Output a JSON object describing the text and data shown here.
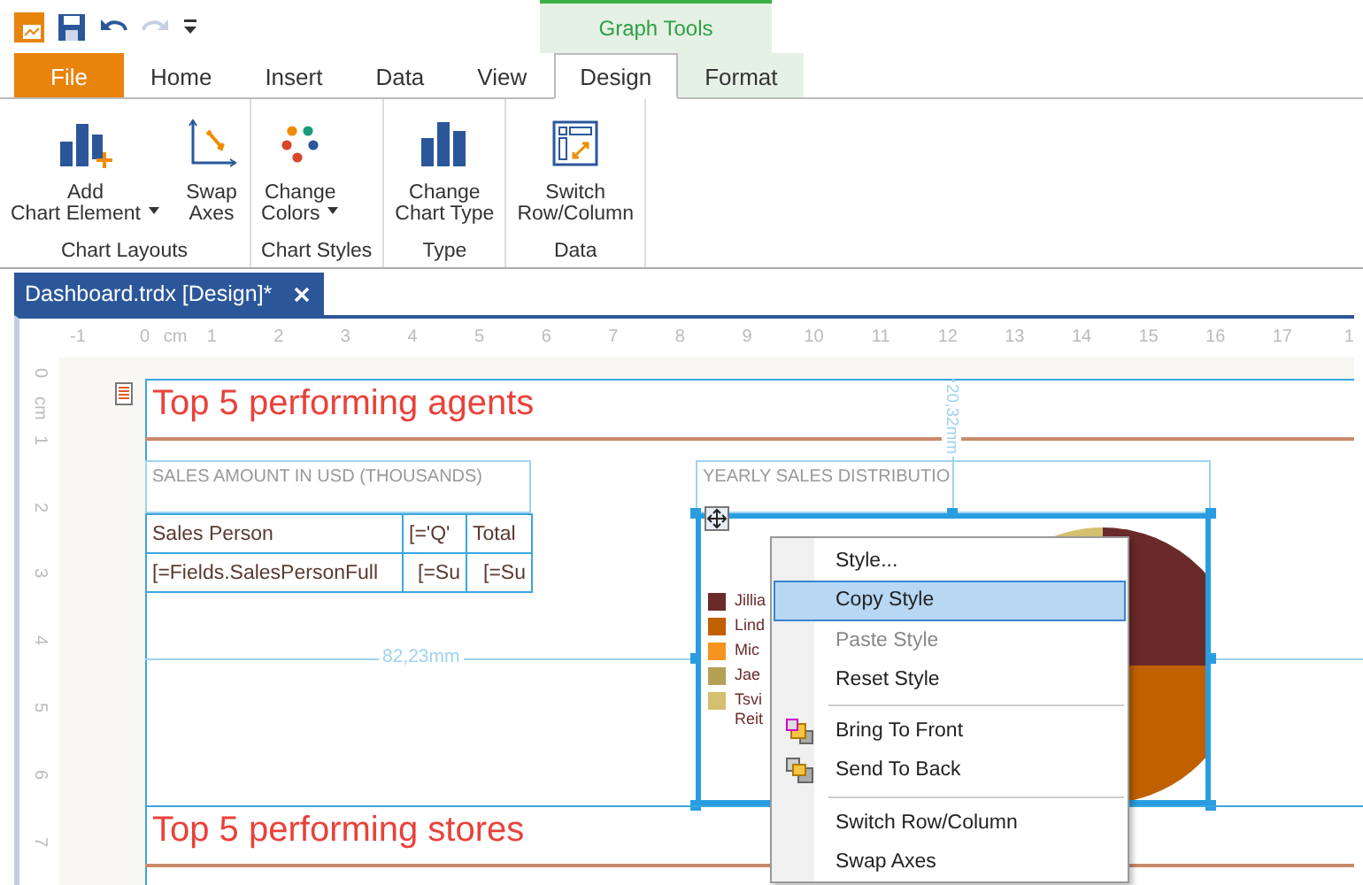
{
  "contextual_group": {
    "label": "Graph Tools"
  },
  "tabs": [
    {
      "label": "File",
      "kind": "file",
      "selected": false
    },
    {
      "label": "Home",
      "kind": "plain",
      "selected": false
    },
    {
      "label": "Insert",
      "kind": "plain",
      "selected": false
    },
    {
      "label": "Data",
      "kind": "plain",
      "selected": false
    },
    {
      "label": "View",
      "kind": "plain",
      "selected": false
    },
    {
      "label": "Design",
      "kind": "contextual",
      "selected": true
    },
    {
      "label": "Format",
      "kind": "contextual",
      "selected": false
    }
  ],
  "ribbon_groups": [
    {
      "label": "Chart Layouts",
      "buttons": [
        {
          "kind": "add",
          "lines": [
            "Add",
            "Chart Element"
          ],
          "dropdown": true
        },
        {
          "kind": "swap",
          "lines": [
            "Swap",
            "Axes"
          ],
          "dropdown": false
        }
      ]
    },
    {
      "label": "Chart Styles",
      "buttons": [
        {
          "kind": "colors",
          "lines": [
            "Change",
            "Colors"
          ],
          "dropdown": true
        }
      ]
    },
    {
      "label": "Type",
      "buttons": [
        {
          "kind": "type",
          "lines": [
            "Change",
            "Chart Type"
          ],
          "dropdown": false
        }
      ]
    },
    {
      "label": "Data",
      "buttons": [
        {
          "kind": "switch",
          "lines": [
            "Switch",
            "Row/Column"
          ],
          "dropdown": false
        }
      ]
    }
  ],
  "document_tab": {
    "title": "Dashboard.trdx [Design]*"
  },
  "ruler": {
    "unit_horizontal": "cm",
    "unit_vertical": "cm",
    "horizontal": [
      "-1",
      "0",
      "1",
      "2",
      "3",
      "4",
      "5",
      "6",
      "7",
      "8",
      "9",
      "10",
      "11",
      "12",
      "13",
      "14",
      "15",
      "16",
      "17",
      "1"
    ],
    "vertical": [
      "0",
      "1",
      "2",
      "3",
      "4",
      "5",
      "6",
      "7"
    ]
  },
  "report": {
    "agents_title": "Top 5 performing agents",
    "sales_title": "SALES AMOUNT IN USD (THOUSANDS)",
    "table": {
      "rows": [
        [
          "Sales Person",
          "[='Q'",
          "Total"
        ],
        [
          "[=Fields.SalesPersonFull",
          "[=Su",
          "[=Su"
        ]
      ]
    },
    "width_measure": "82,23mm",
    "height_measure": "20,32mm",
    "pie_title": "YEARLY SALES DISTRIBUTIO",
    "legend": [
      {
        "label": "Jillia",
        "color": "#6b2a2a"
      },
      {
        "label": "Lind",
        "color": "#c06000"
      },
      {
        "label": "Mic",
        "color": "#f7941d"
      },
      {
        "label": "Jae",
        "color": "#b5a055"
      },
      {
        "label": "Tsvi Reit",
        "color": "#d4c070"
      }
    ],
    "stores_title": "Top 5 performing stores"
  },
  "context_menu": {
    "items": [
      {
        "kind": "item",
        "label": "Style...",
        "selected": false,
        "disabled": false
      },
      {
        "kind": "item",
        "label": "Copy Style",
        "selected": true,
        "disabled": false
      },
      {
        "kind": "item",
        "label": "Paste Style",
        "selected": false,
        "disabled": true
      },
      {
        "kind": "item",
        "label": "Reset Style",
        "selected": false,
        "disabled": false
      },
      {
        "kind": "separator"
      },
      {
        "kind": "front",
        "label": "Bring To Front",
        "selected": false,
        "disabled": false
      },
      {
        "kind": "back",
        "label": "Send To Back",
        "selected": false,
        "disabled": false
      },
      {
        "kind": "separator"
      },
      {
        "kind": "item",
        "label": "Switch Row/Column",
        "selected": false,
        "disabled": false
      },
      {
        "kind": "item",
        "label": "Swap Axes",
        "selected": false,
        "disabled": false
      }
    ]
  }
}
